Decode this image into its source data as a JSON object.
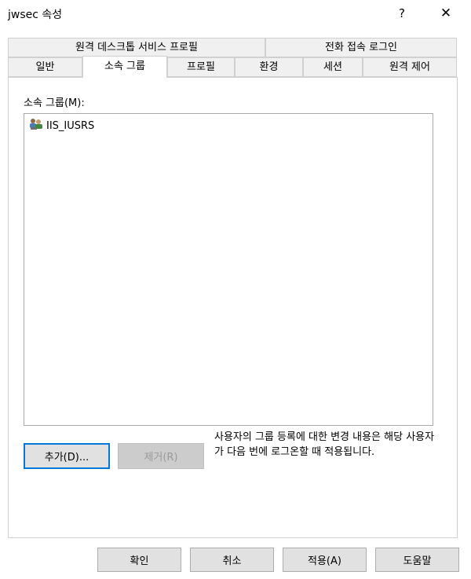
{
  "window": {
    "title": "jwsec 속성",
    "help_label": "?",
    "close_label": "✕"
  },
  "tabs": {
    "row1": [
      "원격 데스크톱 서비스 프로필",
      "전화 접속 로그인"
    ],
    "row2": [
      "일반",
      "소속 그룹",
      "프로필",
      "환경",
      "세션",
      "원격 제어"
    ],
    "active": "소속 그룹"
  },
  "member_of": {
    "label": "소속 그룹(M):",
    "items": [
      {
        "name": "IIS_IUSRS",
        "icon": "group-icon"
      }
    ]
  },
  "actions": {
    "add_label": "추가(D)...",
    "remove_label": "제거(R)",
    "note": "사용자의 그룹 등록에 대한 변경 내용은 해당 사용자가 다음 번에 로그온할 때 적용됩니다."
  },
  "footer": {
    "ok_label": "확인",
    "cancel_label": "취소",
    "apply_label": "적용(A)",
    "help_label": "도움말"
  },
  "colors": {
    "focus_border": "#0078d7",
    "button_face": "#e1e1e1",
    "disabled_face": "#cccccc"
  }
}
